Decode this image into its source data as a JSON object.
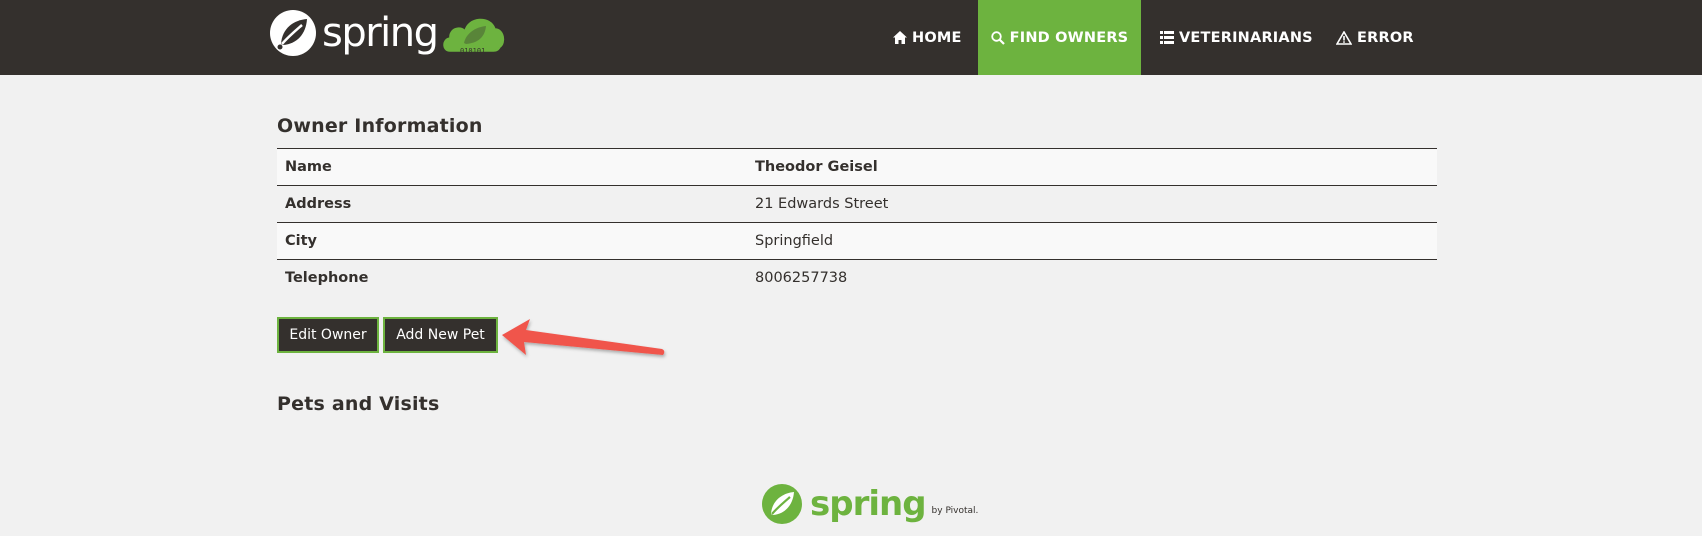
{
  "brand": {
    "name": "spring",
    "cloud_digits": "010101"
  },
  "nav": {
    "items": [
      {
        "label": "HOME",
        "icon": "home-icon"
      },
      {
        "label": "FIND OWNERS",
        "icon": "search-icon",
        "active": true
      },
      {
        "label": "VETERINARIANS",
        "icon": "list-icon"
      },
      {
        "label": "ERROR",
        "icon": "warning-icon"
      }
    ]
  },
  "owner": {
    "title": "Owner Information",
    "rows": [
      {
        "label": "Name",
        "value": "Theodor Geisel"
      },
      {
        "label": "Address",
        "value": "21 Edwards Street"
      },
      {
        "label": "City",
        "value": "Springfield"
      },
      {
        "label": "Telephone",
        "value": "8006257738"
      }
    ]
  },
  "buttons": {
    "edit_owner": "Edit Owner",
    "add_new_pet": "Add New Pet"
  },
  "pets": {
    "title": "Pets and Visits"
  },
  "footer": {
    "brand": "spring",
    "by": "by Pivotal."
  },
  "colors": {
    "nav_bg": "#34302d",
    "accent": "#6db33f",
    "page_bg": "#f1f1f1",
    "arrow": "#f0544b"
  }
}
